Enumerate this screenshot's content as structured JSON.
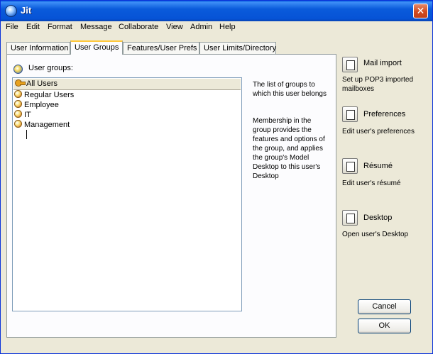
{
  "window": {
    "title": "Jit"
  },
  "menu": [
    "File",
    "Edit",
    "Format",
    "Message",
    "Collaborate",
    "View",
    "Admin",
    "Help"
  ],
  "tabs": [
    {
      "label": "User Information",
      "active": false
    },
    {
      "label": "User Groups",
      "active": true
    },
    {
      "label": "Features/User Prefs",
      "active": false
    },
    {
      "label": "User Limits/Directory",
      "active": false
    }
  ],
  "groups": {
    "label": "User groups:",
    "header": "All Users",
    "items": [
      "Regular Users",
      "Employee",
      "IT",
      "Management"
    ]
  },
  "description": {
    "p1": "The list of groups to which this user belongs",
    "p2": "Membership in the group provides the features and options of the group, and applies the group's Model Desktop to this user's Desktop"
  },
  "actions": [
    {
      "title": "Mail import",
      "desc1": "Set up POP3 imported",
      "desc2": "mailboxes",
      "icon": "mail-import-icon"
    },
    {
      "title": "Preferences",
      "desc1": "Edit user's preferences",
      "desc2": "",
      "icon": "preferences-icon"
    },
    {
      "title": "Résumé",
      "desc1": "Edit user's résumé",
      "desc2": "",
      "icon": "resume-icon"
    },
    {
      "title": "Desktop",
      "desc1": "Open user's Desktop",
      "desc2": "",
      "icon": "desktop-icon"
    }
  ],
  "buttons": {
    "cancel": "Cancel",
    "ok": "OK"
  }
}
